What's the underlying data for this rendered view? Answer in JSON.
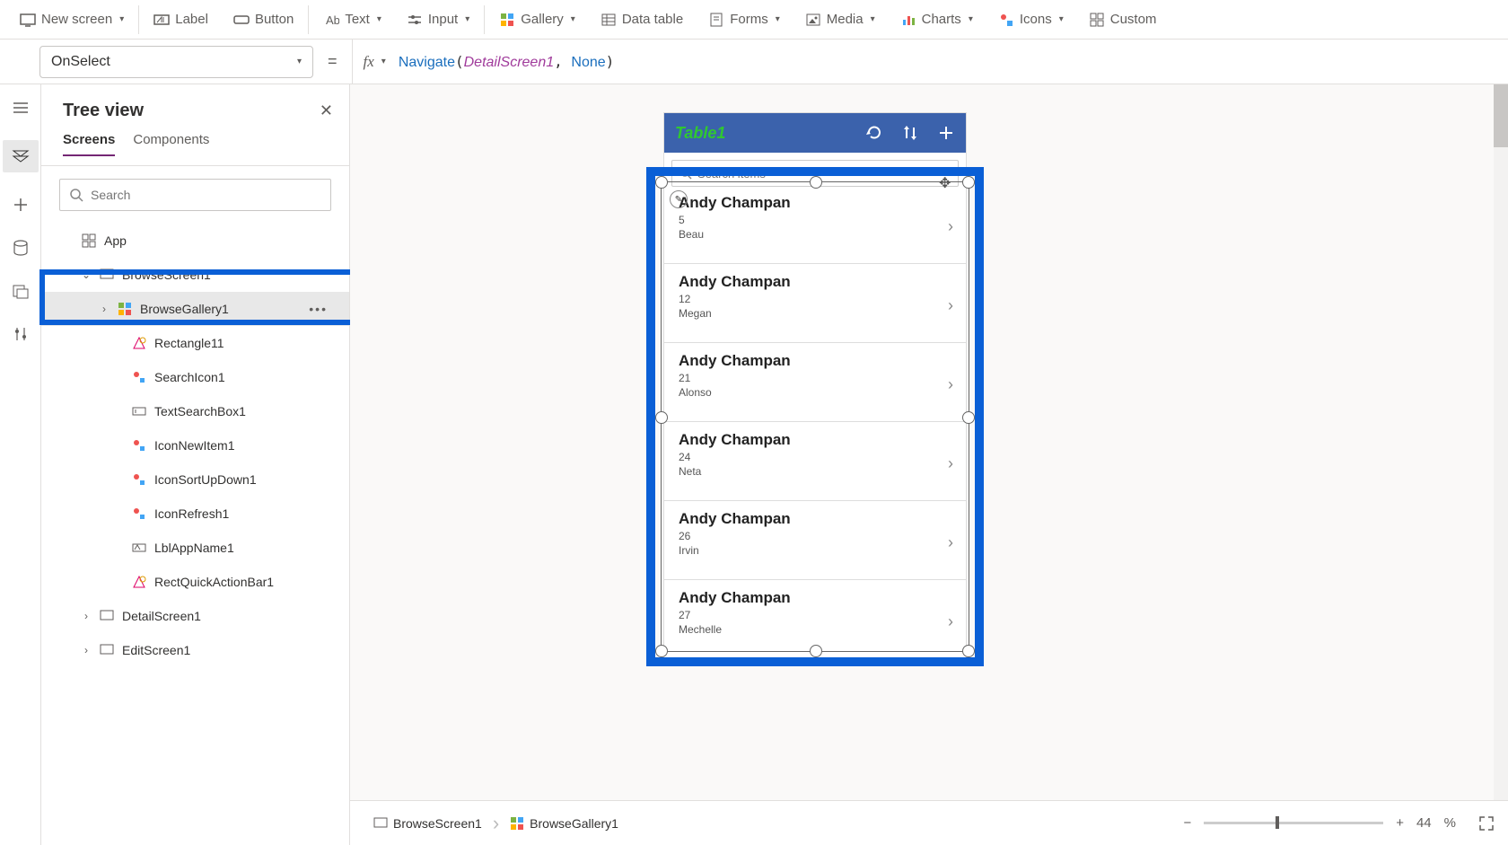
{
  "ribbon": {
    "new_screen": "New screen",
    "label": "Label",
    "button": "Button",
    "text": "Text",
    "input": "Input",
    "gallery": "Gallery",
    "data_table": "Data table",
    "forms": "Forms",
    "media": "Media",
    "charts": "Charts",
    "icons": "Icons",
    "custom": "Custom"
  },
  "formula": {
    "property": "OnSelect",
    "fn": "Navigate",
    "arg1": "DetailScreen1",
    "arg2": "None"
  },
  "tree": {
    "title": "Tree view",
    "tabs": {
      "screens": "Screens",
      "components": "Components"
    },
    "search_placeholder": "Search",
    "items": {
      "app": "App",
      "browse_screen": "BrowseScreen1",
      "browse_gallery": "BrowseGallery1",
      "rectangle": "Rectangle11",
      "search_icon": "SearchIcon1",
      "text_search": "TextSearchBox1",
      "icon_new": "IconNewItem1",
      "icon_sort": "IconSortUpDown1",
      "icon_refresh": "IconRefresh1",
      "lbl_app": "LblAppName1",
      "rect_quick": "RectQuickActionBar1",
      "detail_screen": "DetailScreen1",
      "edit_screen": "EditScreen1"
    }
  },
  "phone": {
    "title": "Table1",
    "search_placeholder": "Search items",
    "rows": [
      {
        "title": "Andy Champan",
        "sub1": "5",
        "sub2": "Beau"
      },
      {
        "title": "Andy Champan",
        "sub1": "12",
        "sub2": "Megan"
      },
      {
        "title": "Andy Champan",
        "sub1": "21",
        "sub2": "Alonso"
      },
      {
        "title": "Andy Champan",
        "sub1": "24",
        "sub2": "Neta"
      },
      {
        "title": "Andy Champan",
        "sub1": "26",
        "sub2": "Irvin"
      },
      {
        "title": "Andy Champan",
        "sub1": "27",
        "sub2": "Mechelle"
      }
    ]
  },
  "breadcrumb": {
    "screen": "BrowseScreen1",
    "control": "BrowseGallery1"
  },
  "zoom": {
    "value": "44",
    "unit": "%"
  }
}
